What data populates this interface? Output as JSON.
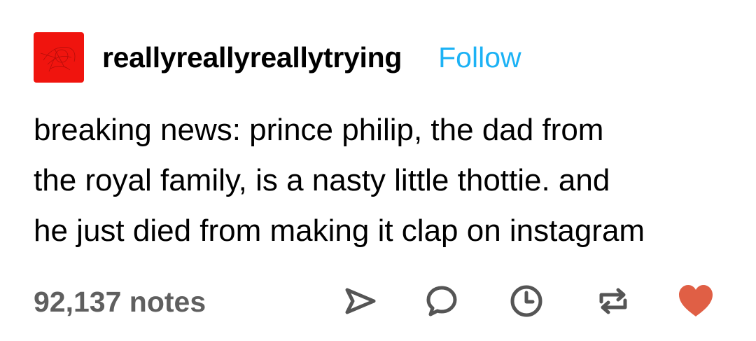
{
  "post": {
    "author": {
      "username": "reallyreallyreallytrying",
      "avatar_color": "#f0140e",
      "avatar_icon": "red-abstract-sketch"
    },
    "follow_label": "Follow",
    "follow_color": "#1cb2f5",
    "body_lines": [
      "breaking news: prince philip, the dad from",
      "the royal family, is a nasty little thottie. and",
      "he just died from making it clap on instagram"
    ],
    "notes_label": "92,137 notes",
    "actions": {
      "share_icon": "paper-plane-icon",
      "reply_icon": "speech-bubble-icon",
      "schedule_icon": "clock-icon",
      "reblog_icon": "reblog-icon",
      "like_icon": "heart-icon",
      "icon_color": "#555555",
      "like_color": "#e05f45"
    }
  }
}
